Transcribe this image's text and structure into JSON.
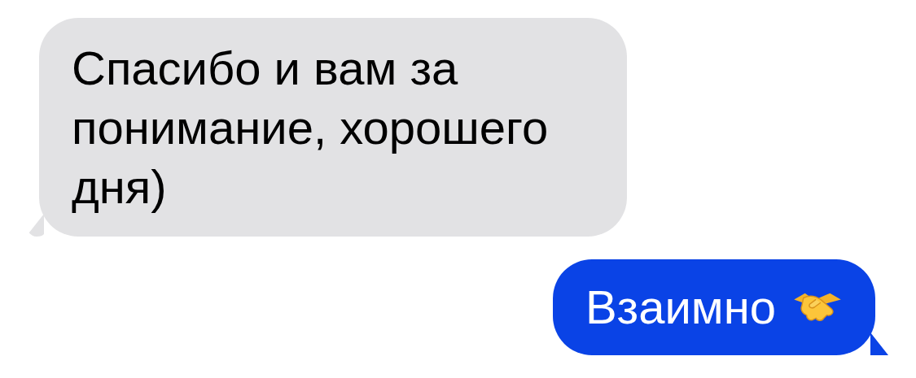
{
  "messages": [
    {
      "outgoing": false,
      "text": "Спасибо и вам за понимание, хорошего дня)",
      "has_icon": false
    },
    {
      "outgoing": true,
      "text": "Взаимно",
      "has_icon": true
    }
  ]
}
